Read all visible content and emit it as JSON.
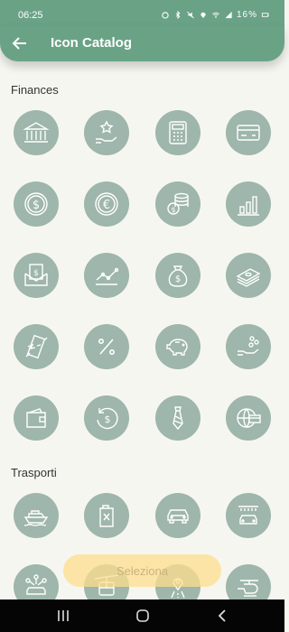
{
  "status": {
    "time": "06:25",
    "battery": "16%"
  },
  "appbar": {
    "title": "Icon Catalog"
  },
  "sections": [
    {
      "label": "Finances",
      "icons": [
        "bank-icon",
        "hand-star-icon",
        "calculator-icon",
        "credit-card-icon",
        "dollar-coin-icon",
        "euro-coin-icon",
        "coin-stack-icon",
        "bar-chart-icon",
        "money-envelope-icon",
        "line-chart-icon",
        "money-bag-icon",
        "cash-stack-icon",
        "broken-chain-icon",
        "percent-icon",
        "piggy-bank-icon",
        "hand-coins-icon",
        "wallet-icon",
        "dollar-refresh-icon",
        "tie-icon",
        "globe-card-icon"
      ]
    },
    {
      "label": "Trasporti",
      "icons": [
        "ship-icon",
        "fuel-can-icon",
        "car-icon",
        "car-wash-icon",
        "network-car-icon",
        "cable-car-icon",
        "location-road-icon",
        "helicopter-icon"
      ]
    }
  ],
  "fab": {
    "label": "Seleziona"
  },
  "colors": {
    "accent": "#6aa286",
    "icon_bg": "#9eb6ab",
    "fab": "#fdd98c"
  }
}
